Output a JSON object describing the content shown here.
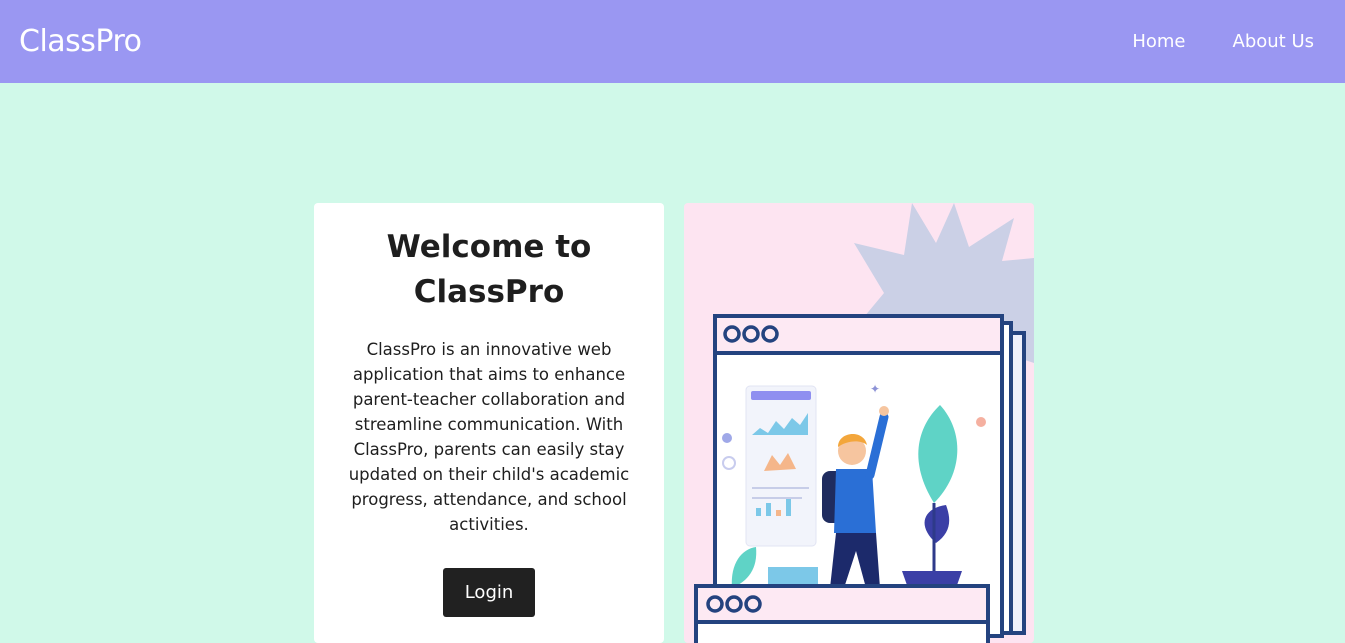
{
  "navbar": {
    "brand": "ClassPro",
    "links": [
      {
        "label": "Home"
      },
      {
        "label": "About Us"
      }
    ]
  },
  "hero": {
    "title": "Welcome to ClassPro",
    "description": "ClassPro is an innovative web application that aims to enhance parent-teacher collaboration and streamline communication. With ClassPro, parents can easily stay updated on their child's academic progress, attendance, and school activities.",
    "login_label": "Login"
  },
  "illustration": {
    "icon": "student-dashboard-illustration"
  },
  "colors": {
    "navbar": "#9a97f2",
    "background": "#d0f9e9",
    "card": "#ffffff",
    "illustration_bg": "#fde4f1",
    "button": "#212121"
  }
}
